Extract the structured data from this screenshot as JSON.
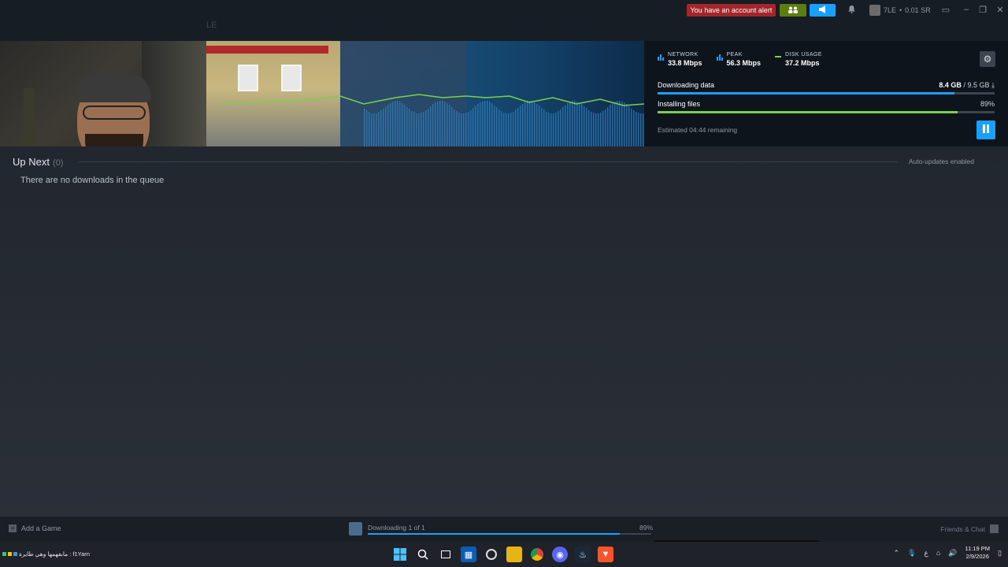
{
  "top": {
    "ghost_tab": "LE",
    "alert": "You have an account alert",
    "account_label": "7LE",
    "wallet": "0.01 SR",
    "colors": {
      "alert": "#a3262a",
      "friends": "#5c7e10",
      "announce": "#1a9fff"
    }
  },
  "stats": {
    "network_label": "NETWORK",
    "network_value": "33.8 Mbps",
    "peak_label": "PEAK",
    "peak_value": "56.3 Mbps",
    "disk_label": "DISK USAGE",
    "disk_value": "37.2 Mbps"
  },
  "progress": {
    "downloading_label": "Downloading data",
    "downloaded": "8.4 GB",
    "separator": "/",
    "total": "9.5 GB",
    "download_fraction": 0.88,
    "installing_label": "Installing files",
    "install_pct": "89%",
    "install_fraction": 0.89,
    "eta": "Estimated 04:44 remaining"
  },
  "queue": {
    "title": "Up Next",
    "count": "(0)",
    "auto_updates": "Auto-updates enabled",
    "empty": "There are no downloads in the queue"
  },
  "bottom": {
    "add_game": "Add a Game",
    "downloading": "Downloading 1 of 1",
    "pct": "89%",
    "fraction": 0.89,
    "friends": "Friends & Chat"
  },
  "taskbar": {
    "ticker": "مابفهمها وهي طايرة : f1Yarn",
    "lang": "ع",
    "time": "11:19 PM",
    "date": "2/9/2026",
    "icons": [
      "windows-start-icon",
      "search-icon",
      "task-view-icon",
      "store-icon",
      "obs-icon",
      "file-explorer-icon",
      "chrome-icon",
      "discord-icon",
      "steam-icon",
      "brave-icon"
    ]
  }
}
